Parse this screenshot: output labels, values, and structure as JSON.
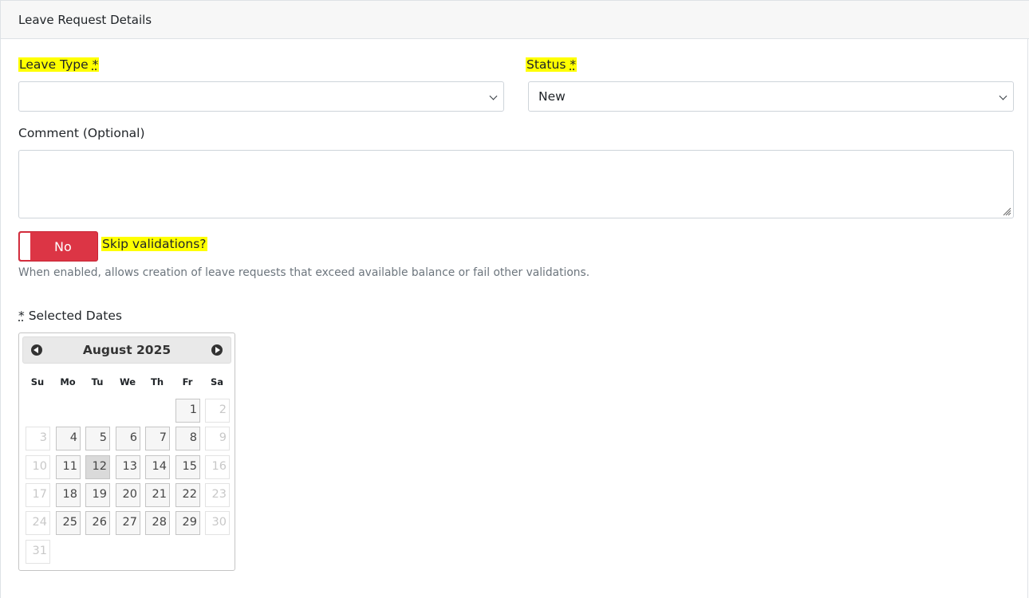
{
  "panel": {
    "title": "Leave Request Details"
  },
  "form": {
    "leave_type_label": "Leave Type",
    "required_star": "*",
    "leave_type_value": "",
    "status_label": "Status",
    "status_value": "New",
    "comment_label": "Comment (Optional)",
    "comment_value": "",
    "skip_toggle_text": "No",
    "skip_label": "Skip validations?",
    "skip_help": "When enabled, allows creation of leave requests that exceed available balance or fail other validations.",
    "selected_dates_label": "Selected Dates"
  },
  "colors": {
    "highlight": "#ffff00",
    "toggle_off": "#dc3545"
  },
  "calendar": {
    "title": "August 2025",
    "prev_icon": "circle-triangle-left-icon",
    "next_icon": "circle-triangle-right-icon",
    "weekdays": [
      "Su",
      "Mo",
      "Tu",
      "We",
      "Th",
      "Fr",
      "Sa"
    ],
    "first_weekday_index": 5,
    "days_in_month": 31,
    "disabled_days": [
      2,
      3,
      9,
      10,
      16,
      17,
      23,
      24,
      30,
      31
    ],
    "highlighted_day": 12
  }
}
